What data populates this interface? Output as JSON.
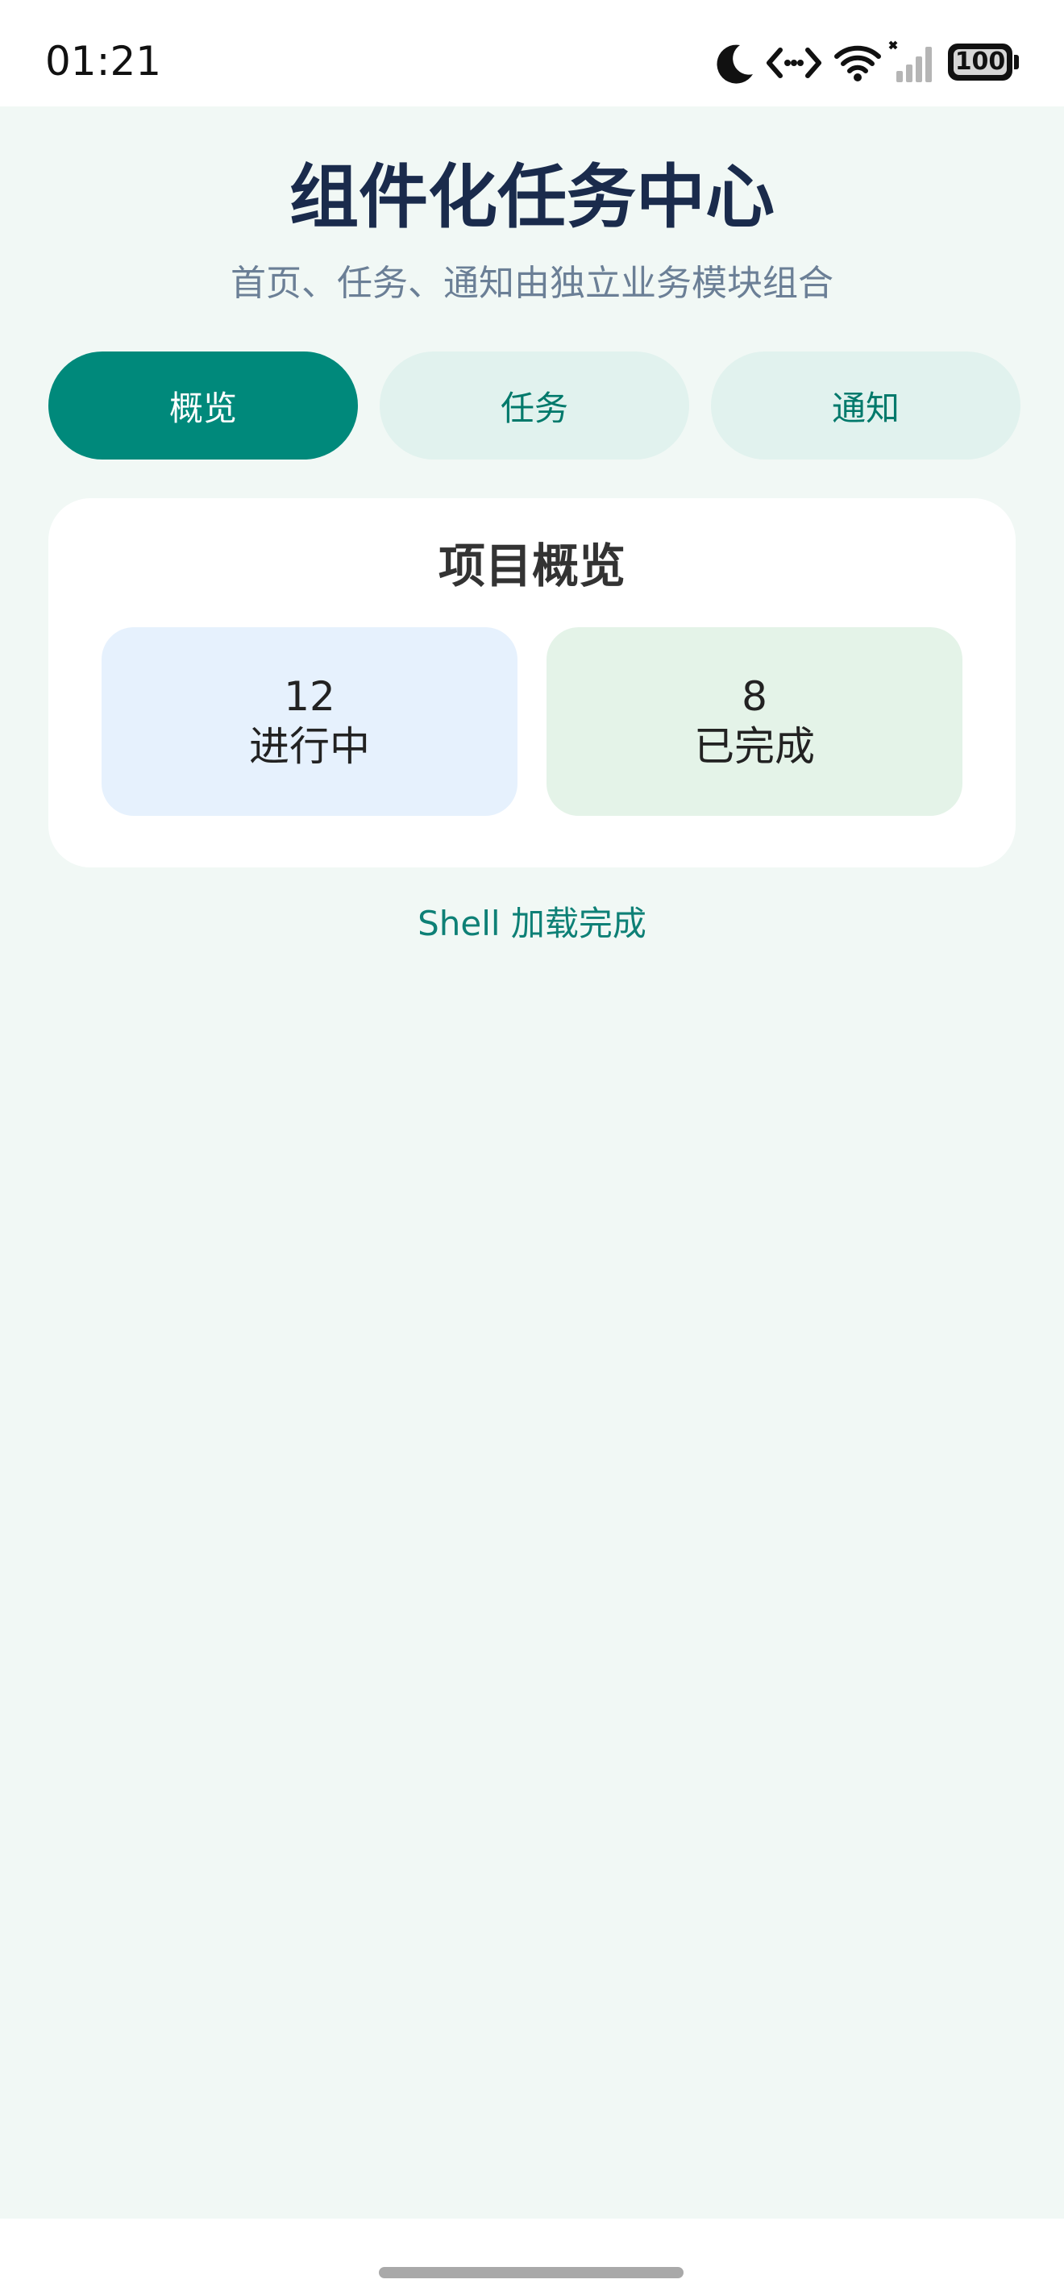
{
  "status_bar": {
    "time": "01:21",
    "battery_level": "100",
    "icons": [
      "moon-icon",
      "code-icon",
      "wifi-icon",
      "signal-icon",
      "battery-icon"
    ]
  },
  "header": {
    "title": "组件化任务中心",
    "subtitle": "首页、任务、通知由独立业务模块组合"
  },
  "tabs": [
    {
      "label": "概览",
      "active": true
    },
    {
      "label": "任务",
      "active": false
    },
    {
      "label": "通知",
      "active": false
    }
  ],
  "overview": {
    "title": "项目概览",
    "stats": [
      {
        "value": "12",
        "label": "进行中"
      },
      {
        "value": "8",
        "label": "已完成"
      }
    ]
  },
  "footer_status": "Shell 加载完成",
  "colors": {
    "accent": "#00897b",
    "tab_inactive_bg": "#e1f2ee",
    "page_bg": "#f1f8f5",
    "title": "#1a2b4c",
    "stat_blue_bg": "#e6f1fd",
    "stat_green_bg": "#e4f3e8"
  }
}
